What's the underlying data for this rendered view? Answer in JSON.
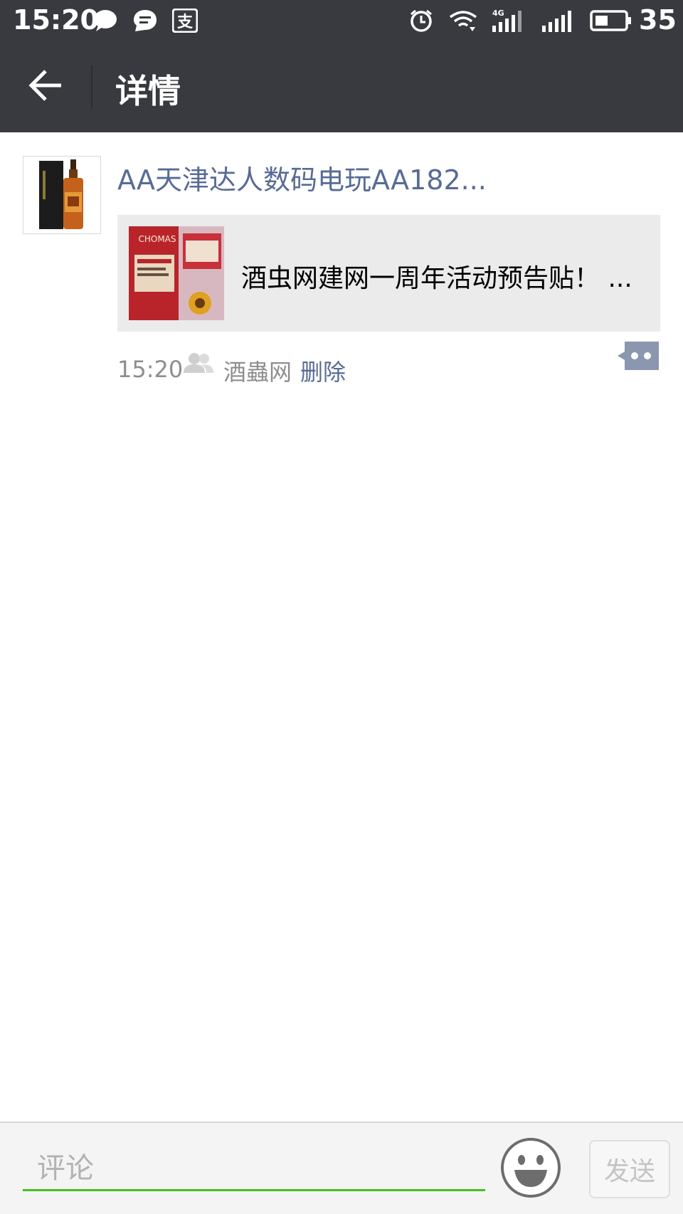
{
  "status_bar": {
    "time": "15:20",
    "battery_level": "35",
    "icons": [
      "chat-bubble-icon",
      "message-icon",
      "alipay-icon",
      "alarm-icon",
      "wifi-icon",
      "signal-4g-icon",
      "signal-icon",
      "battery-icon"
    ]
  },
  "header": {
    "title": "详情",
    "back_icon": "arrow-left-icon"
  },
  "post": {
    "author": "AA天津达人数码电玩AA182...",
    "link_card": {
      "title": "酒虫网建网一周年活动预告贴！ ..."
    },
    "time": "15:20",
    "group_name": "酒蟲网",
    "delete_label": "删除"
  },
  "comment_bar": {
    "placeholder": "评论",
    "send_label": "发送"
  },
  "colors": {
    "bar_bg": "#393a3f",
    "link_blue": "#576b95",
    "accent_green": "#45c01a",
    "card_bg": "#ebebeb"
  }
}
